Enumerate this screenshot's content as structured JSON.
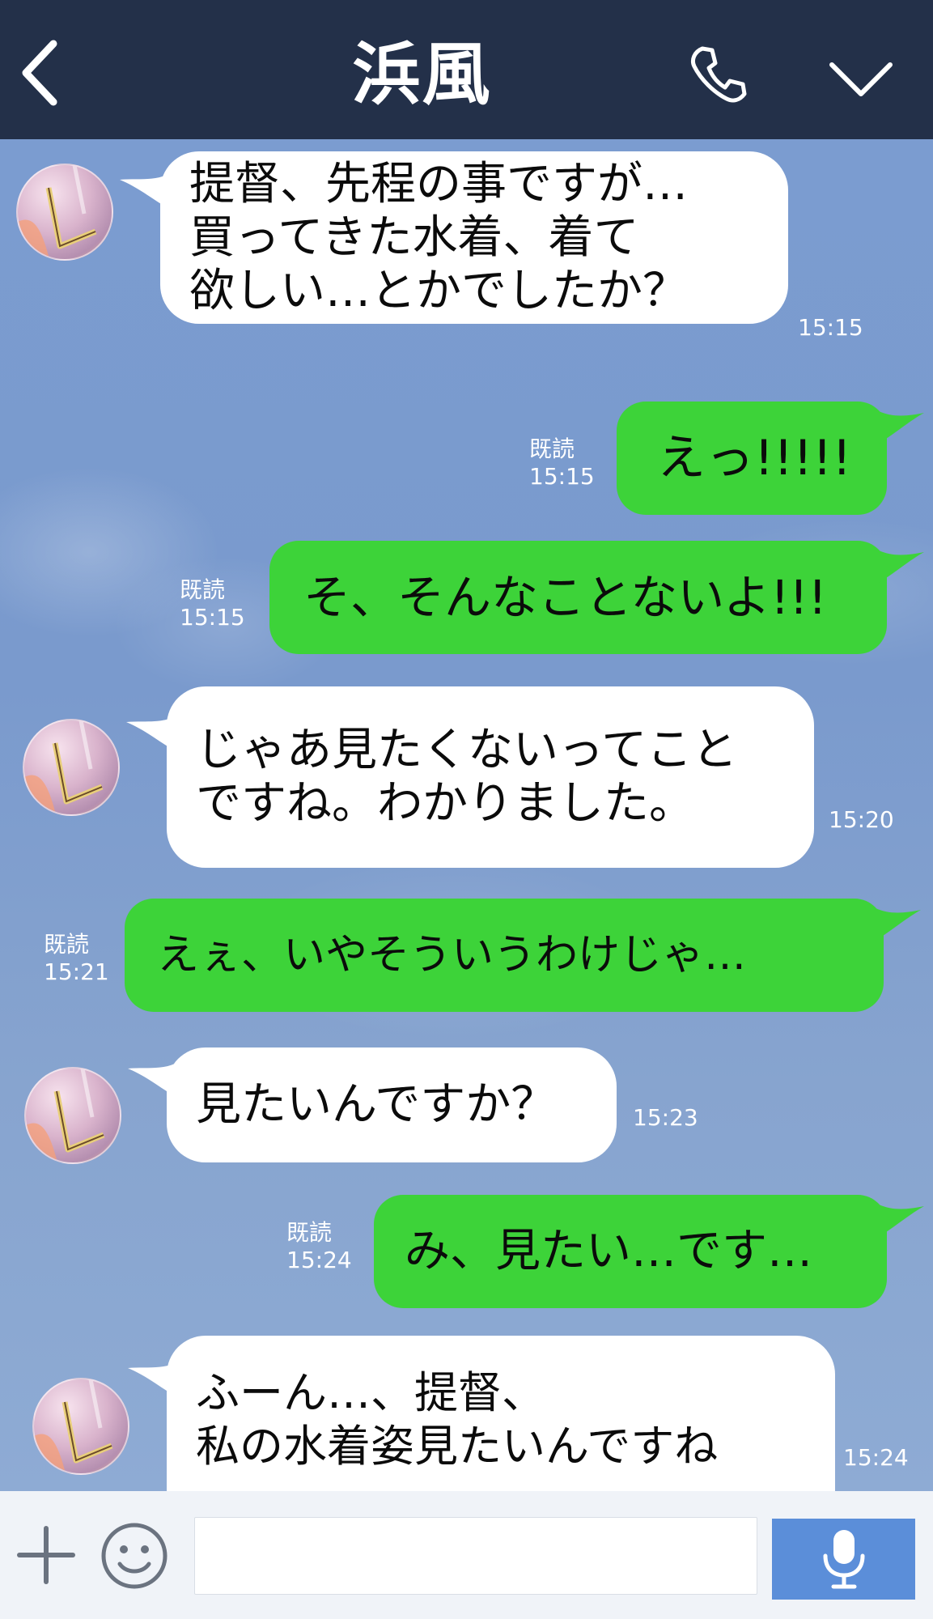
{
  "header": {
    "title": "浜風"
  },
  "messages": [
    {
      "side": "in",
      "text": "提督、先程の事ですが…\n買ってきた水着、着て\n欲しい…とかでしたか？",
      "time": "15:15"
    },
    {
      "side": "out",
      "text": "えっ!!!!!",
      "read": "既読",
      "time": "15:15"
    },
    {
      "side": "out",
      "text": "そ、そんなことないよ!!!",
      "read": "既読",
      "time": "15:15"
    },
    {
      "side": "in",
      "text": "じゃあ見たくないってこと\nですね。わかりました。",
      "time": "15:20"
    },
    {
      "side": "out",
      "text": "えぇ、いやそういうわけじゃ…",
      "read": "既読",
      "time": "15:21"
    },
    {
      "side": "in",
      "text": "見たいんですか？",
      "time": "15:23"
    },
    {
      "side": "out",
      "text": "み、見たい…です…",
      "read": "既読",
      "time": "15:24"
    },
    {
      "side": "in",
      "text": "ふーん…、提督、\n私の水着姿見たいんですね",
      "time": "15:24"
    }
  ],
  "input": {
    "value": "",
    "placeholder": ""
  },
  "colors": {
    "header_bg": "#233049",
    "chat_bg": "#7d9cc9",
    "incoming_bubble": "#ffffff",
    "outgoing_bubble": "#3dd339",
    "mic_button": "#5b8ed9"
  },
  "icons": {
    "back": "chevron-left-icon",
    "call": "phone-icon",
    "menu": "chevron-down-icon",
    "add": "plus-icon",
    "emoji": "smile-icon",
    "voice": "mic-icon"
  }
}
